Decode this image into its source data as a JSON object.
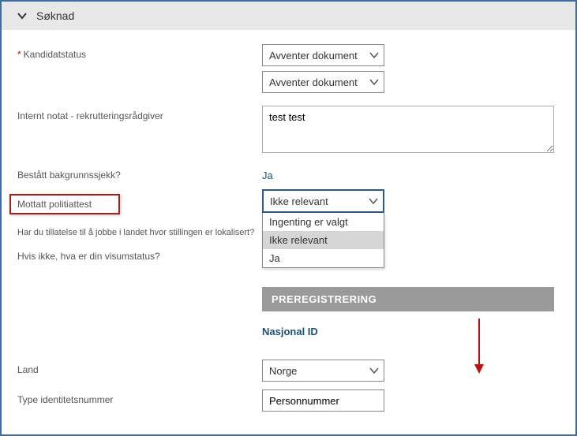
{
  "section": {
    "title": "Søknad"
  },
  "fields": {
    "kandidatstatus_label": "Kandidatstatus",
    "kandidatstatus_value1": "Avventer dokument",
    "kandidatstatus_value2": "Avventer dokument",
    "internt_notat_label": "Internt notat - rekrutteringsrådgiver",
    "internt_notat_value": "test test",
    "bakgrunnssjekk_label": "Bestått bakgrunnssjekk?",
    "bakgrunnssjekk_value": "Ja",
    "politiattest_label": "Mottatt politiattest",
    "politiattest_value": "Ikke relevant",
    "politiattest_options": {
      "opt0": "Ingenting er valgt",
      "opt1": "Ikke relevant",
      "opt2": "Ja"
    },
    "tillatelse_label": "Har du tillatelse til å jobbe i landet hvor stillingen er lokalisert?",
    "visumstatus_label": "Hvis ikke, hva er din visumstatus?",
    "land_label": "Land",
    "land_value": "Norge",
    "type_id_label": "Type identitetsnummer",
    "type_id_value": "Personnummer"
  },
  "subsections": {
    "preregistrering": "PREREGISTRERING",
    "nasjonal_id": "Nasjonal ID"
  }
}
